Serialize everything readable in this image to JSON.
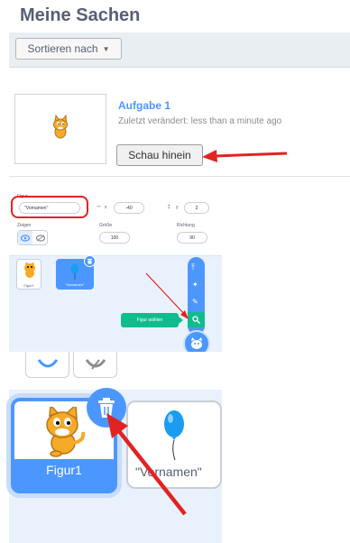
{
  "mystuff": {
    "title": "Meine Sachen",
    "sort_label": "Sortieren nach",
    "project": {
      "title": "Aufgabe 1",
      "modified": "Zuletzt verändert: less than a minute ago",
      "open_button": "Schau hinein"
    }
  },
  "sprite_info": {
    "sprite_label": "Figur",
    "sprite_name": "\"Vornamen\"",
    "x_label": "x",
    "x_value": "-40",
    "y_label": "y",
    "y_value": "2",
    "show_label": "Zeigen",
    "size_label": "Größe",
    "size_value": "100",
    "direction_label": "Richtung",
    "direction_value": "90"
  },
  "sprite_list": {
    "sprites": [
      {
        "label": "Figur1"
      },
      {
        "label": "\"Vornamen\""
      }
    ],
    "tooltip": "Figur wählen"
  },
  "zoom": {
    "sprites": [
      {
        "label": "Figur1"
      },
      {
        "label": "\"Vornamen\""
      }
    ]
  },
  "colors": {
    "accent": "#4c97ff",
    "tooltip": "#0fbd8c",
    "annotation_red": "#e32222"
  }
}
